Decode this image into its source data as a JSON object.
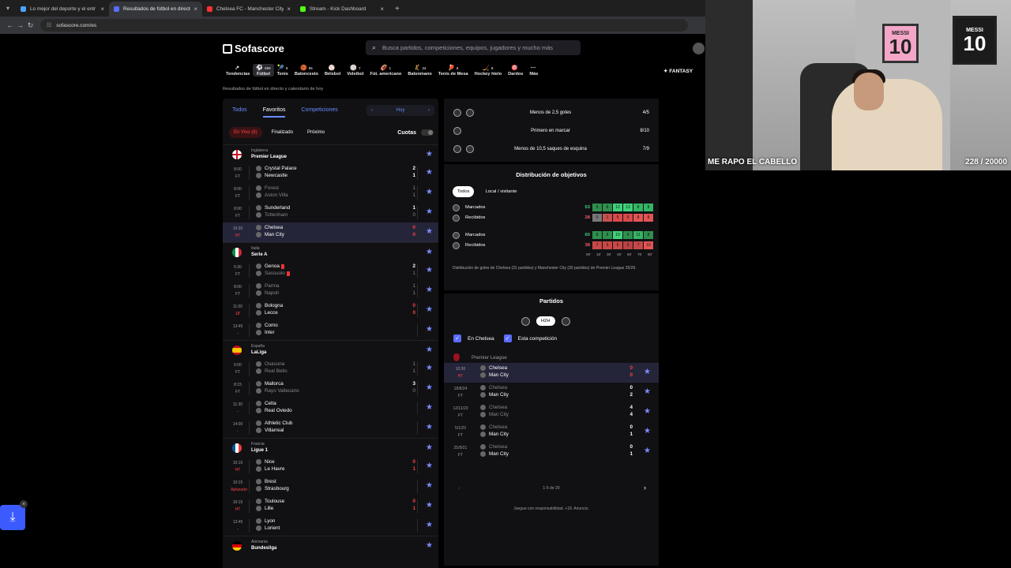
{
  "browser": {
    "tabs": [
      {
        "title": "Lo mejor del deporte y el entr",
        "color": "#4aa3ff",
        "active": false
      },
      {
        "title": "Resultados de fútbol en directo",
        "color": "#5b6cff",
        "active": true
      },
      {
        "title": "Chelsea FC - Manchester City C",
        "color": "#ff3030",
        "active": false
      },
      {
        "title": "Stream - Kick Dashboard",
        "color": "#53fc18",
        "active": false
      }
    ],
    "url": "sofascore.com/es"
  },
  "header": {
    "logo": "Sofascore",
    "search_placeholder": "Busca partidos, competiciones, equipos, jugadores y mucho más",
    "sports": [
      {
        "label": "Tendencias",
        "count": ""
      },
      {
        "label": "Fútbol",
        "count": "699"
      },
      {
        "label": "Tenis",
        "count": "8"
      },
      {
        "label": "Baloncesto",
        "count": "55"
      },
      {
        "label": "Béisbol",
        "count": ""
      },
      {
        "label": "Voleibol",
        "count": "7"
      },
      {
        "label": "Fút. americano",
        "count": "1"
      },
      {
        "label": "Balonmano",
        "count": "34"
      },
      {
        "label": "Tenis de Mesa",
        "count": "8"
      },
      {
        "label": "Hockey hielo",
        "count": "8"
      },
      {
        "label": "Dardos",
        "count": ""
      },
      {
        "label": "Más",
        "count": ""
      }
    ],
    "fantasy": "FANTASY",
    "subline": "Resultados de fútbol en directo y calendario de hoy"
  },
  "left": {
    "tabs": [
      "Todos",
      "Favoritos",
      "Competiciones"
    ],
    "day": "Hoy",
    "filters": [
      "En Vivo (8)",
      "Finalizado",
      "Próximo"
    ],
    "cuotas": "Cuotas",
    "leagues": [
      {
        "country": "Inglaterra",
        "name": "Premier League",
        "flag": "england",
        "matches": [
          {
            "time": "8:00",
            "status": "FT",
            "home": "Crystal Palace",
            "away": "Newcastle",
            "hs": "2",
            "as": "1",
            "hw": true,
            "aw": true
          },
          {
            "time": "8:00",
            "status": "FT",
            "home": "Forest",
            "away": "Aston Villa",
            "hs": "1",
            "as": "1",
            "hw": false,
            "aw": false
          },
          {
            "time": "8:00",
            "status": "FT",
            "home": "Sunderland",
            "away": "Tottenham",
            "hs": "1",
            "as": "0",
            "hw": true,
            "aw": false
          },
          {
            "time": "10:30",
            "status": "HT",
            "home": "Chelsea",
            "away": "Man City",
            "hs": "0",
            "as": "0",
            "hw": true,
            "aw": true,
            "live": true,
            "hl": true
          }
        ]
      },
      {
        "country": "Italia",
        "name": "Serie A",
        "flag": "italy",
        "matches": [
          {
            "time": "5:30",
            "status": "FT",
            "home": "Genoa",
            "away": "Sassuolo",
            "hs": "2",
            "as": "1",
            "hw": true,
            "aw": false,
            "card": true
          },
          {
            "time": "8:00",
            "status": "FT",
            "home": "Parma",
            "away": "Napoli",
            "hs": "1",
            "as": "1",
            "hw": false,
            "aw": false
          },
          {
            "time": "11:00",
            "status": "18'",
            "home": "Bologna",
            "away": "Lecce",
            "hs": "0",
            "as": "0",
            "hw": true,
            "aw": true,
            "live": true
          },
          {
            "time": "13:45",
            "status": "-",
            "home": "Como",
            "away": "Inter",
            "hs": "",
            "as": "",
            "hw": true,
            "aw": true
          }
        ]
      },
      {
        "country": "España",
        "name": "LaLiga",
        "flag": "spain",
        "matches": [
          {
            "time": "6:00",
            "status": "FT",
            "home": "Osasuna",
            "away": "Real Betis",
            "hs": "1",
            "as": "1",
            "hw": false,
            "aw": false
          },
          {
            "time": "8:15",
            "status": "FT",
            "home": "Mallorca",
            "away": "Rayo Vallecano",
            "hs": "3",
            "as": "0",
            "hw": true,
            "aw": false
          },
          {
            "time": "11:30",
            "status": "-",
            "home": "Celta",
            "away": "Real Oviedo",
            "hs": "",
            "as": "",
            "hw": true,
            "aw": true
          },
          {
            "time": "14:00",
            "status": "-",
            "home": "Athletic Club",
            "away": "Villarreal",
            "hs": "",
            "as": "",
            "hw": true,
            "aw": true
          }
        ]
      },
      {
        "country": "Francia",
        "name": "Ligue 1",
        "flag": "france",
        "matches": [
          {
            "time": "10:15",
            "status": "HT",
            "home": "Nice",
            "away": "Le Havre",
            "hs": "0",
            "as": "1",
            "hw": true,
            "aw": true,
            "live": true
          },
          {
            "time": "10:15",
            "status": "Aplazado",
            "home": "Brest",
            "away": "Strasbourg",
            "hs": "",
            "as": "",
            "hw": true,
            "aw": true,
            "live": true
          },
          {
            "time": "10:15",
            "status": "HT",
            "home": "Toulouse",
            "away": "Lille",
            "hs": "0",
            "as": "1",
            "hw": true,
            "aw": true,
            "live": true
          },
          {
            "time": "13:45",
            "status": "-",
            "home": "Lyon",
            "away": "Lorient",
            "hs": "",
            "as": "",
            "hw": true,
            "aw": true
          }
        ]
      },
      {
        "country": "Alemania",
        "name": "Bundesliga",
        "flag": "germany",
        "matches": []
      }
    ]
  },
  "right": {
    "predictions": [
      {
        "text": "Menos de 2,5 goles",
        "value": "4/5",
        "two": true
      },
      {
        "text": "Primero en marcar",
        "value": "8/10",
        "two": false
      },
      {
        "text": "Menos de 10,5 saques de esquina",
        "value": "7/9",
        "two": true
      }
    ],
    "dist_title": "Distribución de objetivos",
    "dist_pills": [
      "Todos",
      "Local / visitante"
    ],
    "dist_rows": [
      {
        "label": "Marcados",
        "total": "53",
        "kind": "g",
        "cells": [
          "5",
          "6",
          "12",
          "13",
          "8",
          "8"
        ],
        "shade": [
          "#2f8f4e",
          "#2f8f4e",
          "#3fd17a",
          "#3fd17a",
          "#34b565",
          "#34b565"
        ]
      },
      {
        "label": "Recibidos",
        "total": "28",
        "kind": "r",
        "cells": [
          "0",
          "1",
          "5",
          "6",
          "8",
          "8"
        ],
        "shade": [
          "#777777",
          "#c85050",
          "#d94a4a",
          "#d94a4a",
          "#e35454",
          "#e35454"
        ]
      },
      {
        "label": "Marcados",
        "total": "60",
        "kind": "g",
        "cells": [
          "8",
          "8",
          "19",
          "6",
          "11",
          "8"
        ],
        "shade": [
          "#2f8f4e",
          "#2f8f4e",
          "#3fd17a",
          "#2f8f4e",
          "#34b565",
          "#2f8f4e"
        ]
      },
      {
        "label": "Recibidos",
        "total": "38",
        "kind": "r",
        "cells": [
          "7",
          "5",
          "6",
          "3",
          "7",
          "10"
        ],
        "shade": [
          "#c84848",
          "#c84848",
          "#c84848",
          "#b84444",
          "#c84848",
          "#e35454"
        ]
      }
    ],
    "axis": [
      "00'",
      "15'",
      "30'",
      "45'",
      "60'",
      "75'",
      "90'"
    ],
    "dist_note": "Distribución de goles de Chelsea (31 partidos) y Manchester City (30 partidos) de Premier League 25/26.",
    "partidos_title": "Partidos",
    "h2h_label": "H2H",
    "checks": [
      "En Chelsea",
      "Esta competición"
    ],
    "competition": "Premier League",
    "h2h": [
      {
        "date": "10:30",
        "status": "HT",
        "home": "Chelsea",
        "away": "Man City",
        "hs": "0",
        "as": "0",
        "live": true,
        "hl": true,
        "hw": true,
        "aw": true
      },
      {
        "date": "18/8/24",
        "status": "FT",
        "home": "Chelsea",
        "away": "Man City",
        "hs": "0",
        "as": "2",
        "hw": false,
        "aw": true
      },
      {
        "date": "12/11/23",
        "status": "FT",
        "home": "Chelsea",
        "away": "Man City",
        "hs": "4",
        "as": "4",
        "hw": false,
        "aw": false
      },
      {
        "date": "5/1/23",
        "status": "FT",
        "home": "Chelsea",
        "away": "Man City",
        "hs": "0",
        "as": "1",
        "hw": false,
        "aw": true
      },
      {
        "date": "25/9/21",
        "status": "FT",
        "home": "Chelsea",
        "away": "Man City",
        "hs": "0",
        "as": "1",
        "hw": false,
        "aw": true
      }
    ],
    "pager": "1-5 de 29",
    "responsible": "Juegue con responsabilidad. +18. Anuncio."
  },
  "cam": {
    "caption": "ME RAPO EL CABELLO",
    "count": "228 / 20000",
    "poster_name": "MESSI",
    "poster_number": "10"
  }
}
